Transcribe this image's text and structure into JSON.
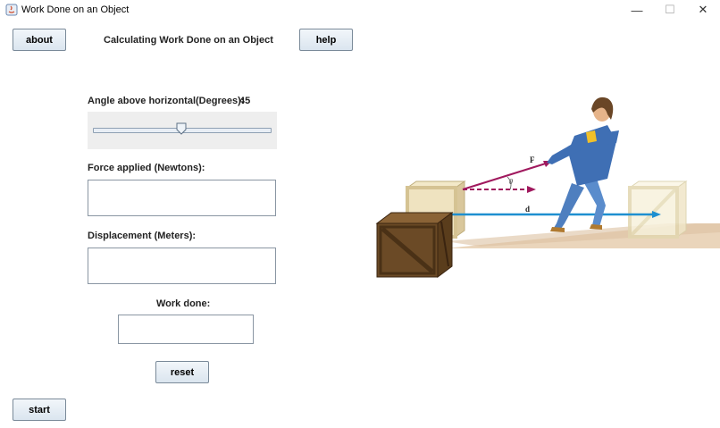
{
  "window": {
    "title": "Work Done on an Object",
    "controls": {
      "minimize": "—",
      "maximize": "☐",
      "close": "✕"
    }
  },
  "header": {
    "about_label": "about",
    "heading": "Calculating Work Done on an Object",
    "help_label": "help"
  },
  "angle": {
    "label": "Angle above horizontal(Degrees):",
    "value": "45",
    "slider_min": 0,
    "slider_max": 90,
    "slider_value": 45
  },
  "force": {
    "label": "Force applied (Newtons):",
    "value": ""
  },
  "displacement": {
    "label": "Displacement (Meters):",
    "value": ""
  },
  "work": {
    "label": "Work done:",
    "value": ""
  },
  "buttons": {
    "reset_label": "reset",
    "start_label": "start"
  },
  "illustration": {
    "force_symbol": "F",
    "angle_symbol": "θ",
    "displacement_symbol": "d",
    "colors": {
      "force": "#a0195e",
      "displacement": "#1e8fd0",
      "crate": "#6b4a26",
      "crate_ghost": "#f3ecd6",
      "floor": "#e8d2b8"
    }
  }
}
